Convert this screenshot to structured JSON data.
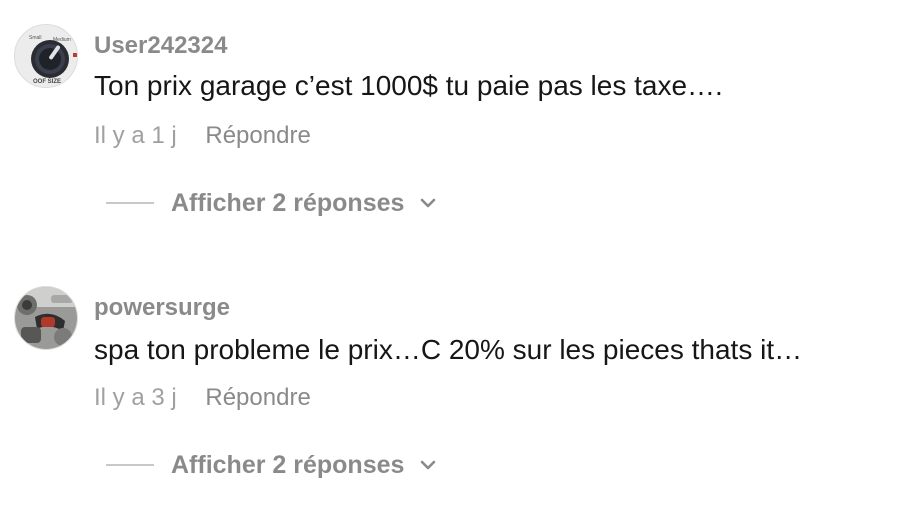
{
  "comments": [
    {
      "username": "User242324",
      "text": "Ton prix garage c’est 1000$ tu paie pas les taxe….",
      "time": "Il y a 1 j",
      "reply_label": "Répondre",
      "view_replies_label": "Afficher 2 réponses",
      "avatar_text": "OOF SIZE",
      "avatar_icon": "knob-dial-icon"
    },
    {
      "username": "powersurge",
      "text": "spa ton probleme le prix…C 20% sur les pieces thats it…",
      "time": "Il y a 3 j",
      "reply_label": "Répondre",
      "view_replies_label": "Afficher 2 réponses",
      "avatar_icon": "engine-photo-icon"
    }
  ],
  "colors": {
    "username": "#8a8a8a",
    "text": "#161616",
    "meta": "#8e8e8e",
    "divider": "#c8c8c8"
  }
}
